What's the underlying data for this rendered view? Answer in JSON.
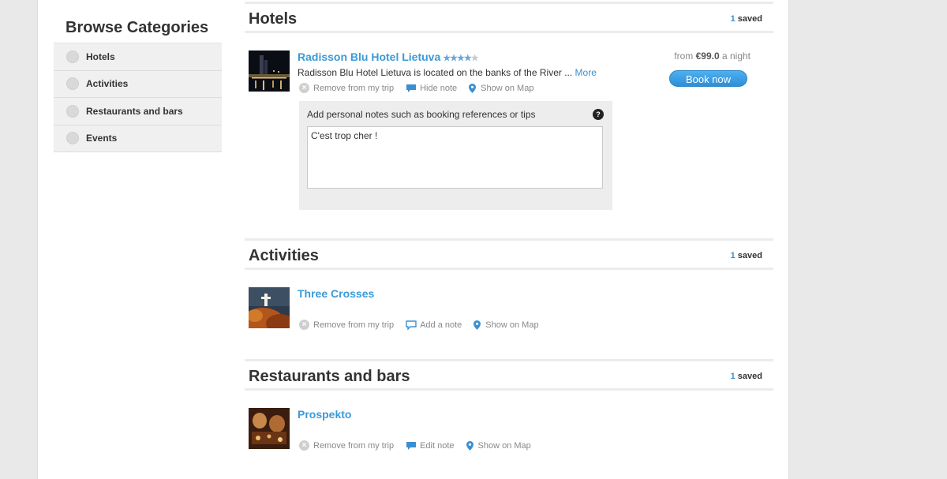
{
  "sidebar": {
    "title": "Browse Categories",
    "items": [
      {
        "label": "Hotels"
      },
      {
        "label": "Activities"
      },
      {
        "label": "Restaurants and bars"
      },
      {
        "label": "Events"
      }
    ]
  },
  "sections": {
    "hotels": {
      "title": "Hotels",
      "saved_count": "1",
      "saved_label": "saved",
      "item": {
        "name": "Radisson Blu Hotel Lietuva",
        "stars_filled": "★★★★",
        "stars_empty": "★",
        "star_rating": 4,
        "description": "Radisson Blu Hotel Lietuva is located on the banks of the River ...",
        "more_link": "More",
        "actions": {
          "remove": "Remove from my trip",
          "note": "Hide note",
          "map": "Show on Map"
        },
        "price_prefix": "from",
        "price_value": "€99.0",
        "price_suffix": "a night",
        "book_label": "Book now",
        "note_label": "Add personal notes such as booking references or tips",
        "note_help": "?",
        "note_text": "C'est trop cher !"
      }
    },
    "activities": {
      "title": "Activities",
      "saved_count": "1",
      "saved_label": "saved",
      "item": {
        "name": "Three Crosses",
        "actions": {
          "remove": "Remove from my trip",
          "note": "Add a note",
          "map": "Show on Map"
        }
      }
    },
    "restaurants": {
      "title": "Restaurants and bars",
      "saved_count": "1",
      "saved_label": "saved",
      "item": {
        "name": "Prospekto",
        "actions": {
          "remove": "Remove from my trip",
          "note": "Edit note",
          "map": "Show on Map"
        }
      }
    }
  },
  "colors": {
    "accent": "#3b9ad8",
    "button": "#2d8fd8",
    "note_bg": "#ededed"
  }
}
